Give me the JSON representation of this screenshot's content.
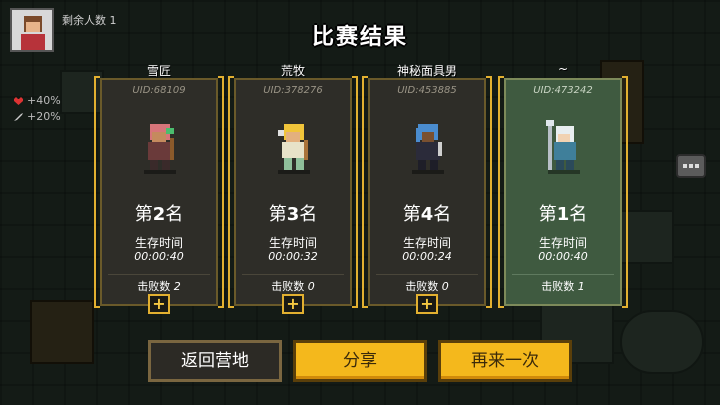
{
  "hud": {
    "remaining_label": "剩余人数 1",
    "stats": [
      "+40%",
      "+20%"
    ]
  },
  "title": "比赛结果",
  "players": [
    {
      "name": "雪匠",
      "uid": "UID:68109",
      "rank_prefix": "第",
      "rank": "2",
      "rank_suffix": "名",
      "survival_label": "生存时间",
      "survival_time": "00:00:40",
      "kills_label": "击败数",
      "kills": "2",
      "winner": false
    },
    {
      "name": "荒牧",
      "uid": "UID:378276",
      "rank_prefix": "第",
      "rank": "3",
      "rank_suffix": "名",
      "survival_label": "生存时间",
      "survival_time": "00:00:32",
      "kills_label": "击败数",
      "kills": "0",
      "winner": false
    },
    {
      "name": "神秘面具男",
      "uid": "UID:453885",
      "rank_prefix": "第",
      "rank": "4",
      "rank_suffix": "名",
      "survival_label": "生存时间",
      "survival_time": "00:00:24",
      "kills_label": "击败数",
      "kills": "0",
      "winner": false
    },
    {
      "name": "~",
      "uid": "UID:473242",
      "rank_prefix": "第",
      "rank": "1",
      "rank_suffix": "名",
      "survival_label": "生存时间",
      "survival_time": "00:00:40",
      "kills_label": "击败数",
      "kills": "1",
      "winner": true
    }
  ],
  "add_friend_label": "+",
  "buttons": {
    "back": "返回营地",
    "share": "分享",
    "again": "再来一次"
  },
  "colors": {
    "accent_gold": "#f4b81c",
    "card_bg": "#2e2d28",
    "winner_bg": "#3f5a40"
  }
}
